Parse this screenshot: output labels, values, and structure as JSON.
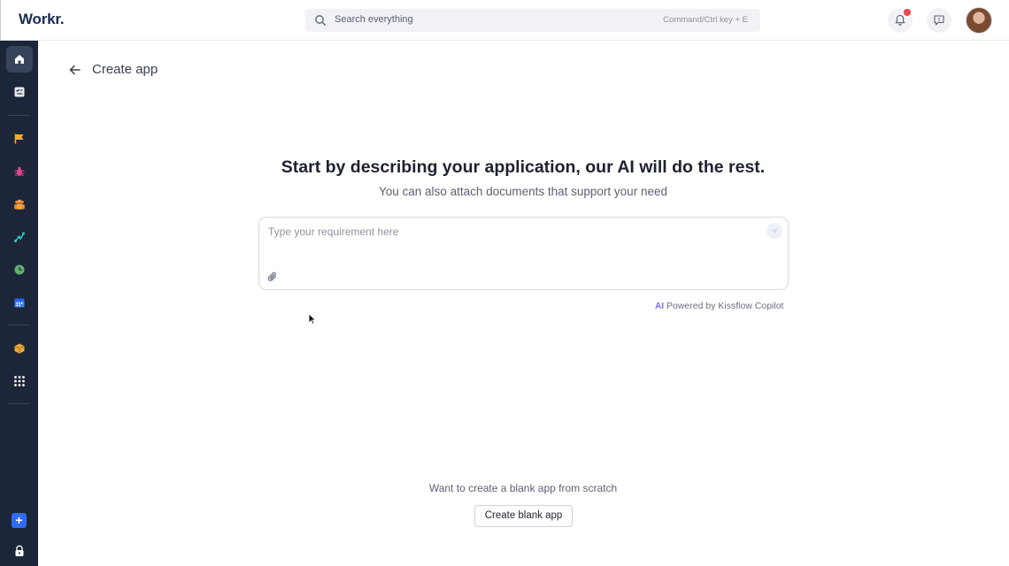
{
  "app": {
    "logo": "Workr."
  },
  "search": {
    "placeholder": "Search everything",
    "shortcut": "Command/Ctrl key + E"
  },
  "header": {
    "icons": [
      "bell-icon",
      "feedback-icon",
      "avatar"
    ],
    "notification_dot_color": "#e5484d"
  },
  "sidebar": {
    "items": [
      {
        "icon": "home-icon",
        "active": true
      },
      {
        "icon": "checklist-icon"
      },
      {
        "icon": "flag-icon"
      },
      {
        "icon": "bug-icon"
      },
      {
        "icon": "team-icon"
      },
      {
        "icon": "flow-icon"
      },
      {
        "icon": "clock-icon"
      },
      {
        "icon": "calendar-icon"
      },
      {
        "icon": "box-icon"
      },
      {
        "icon": "apps-grid-icon"
      },
      {
        "icon": "add-icon"
      },
      {
        "icon": "lock-icon"
      }
    ],
    "colors": {
      "background": "#1c2638",
      "add_button": "#2f6bf0"
    }
  },
  "page": {
    "title": "Create app"
  },
  "main": {
    "heading": "Start by describing your application, our AI will do the rest.",
    "subheading": "You can also attach documents that support your need",
    "prompt_placeholder": "Type your requirement here",
    "powered_prefix": "AI",
    "powered_label": "Powered by Kissflow Copilot",
    "blank_text": "Want to create a blank app from scratch",
    "blank_button": "Create blank app"
  }
}
